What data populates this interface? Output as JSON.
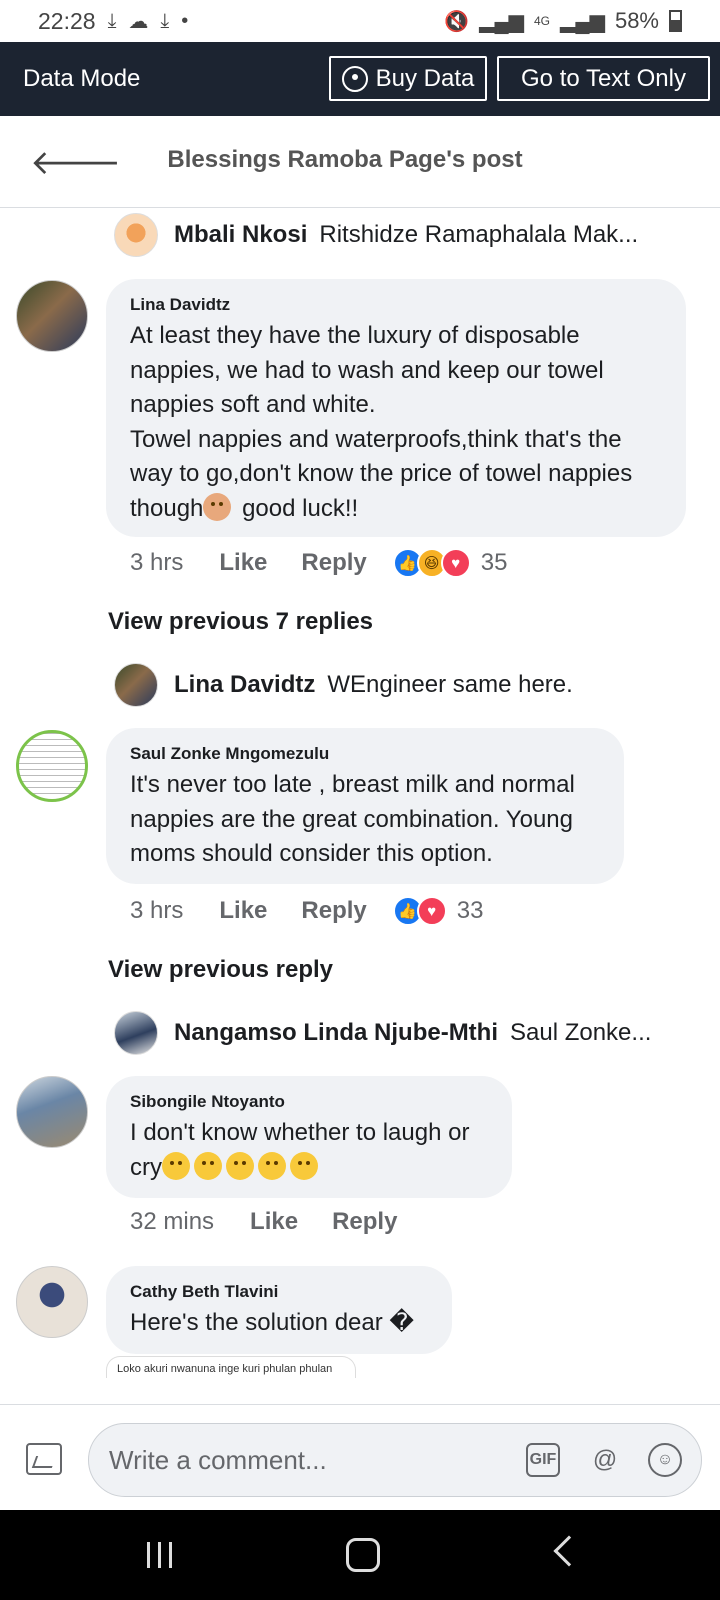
{
  "status_bar": {
    "time": "22:28",
    "network": "4G",
    "battery": "58%"
  },
  "data_bar": {
    "title": "Data Mode",
    "buy_data": "Buy Data",
    "text_only": "Go to Text Only"
  },
  "header": {
    "title": "Blessings Ramoba Page's post"
  },
  "replies": [
    {
      "name": "Mbali Nkosi",
      "text": "Ritshidze Ramaphalala Mak..."
    },
    {
      "name": "Lina Davidtz",
      "text": "WEngineer same here."
    },
    {
      "name": "Nangamso Linda Njube-Mthi",
      "text": "Saul Zonke..."
    }
  ],
  "comments": [
    {
      "name": "Lina Davidtz",
      "text": "At least they have the luxury of disposable nappies, we had to wash and keep our towel nappies soft and white.\nTowel nappies and waterproofs,think that's the way to go,don't know the price of towel nappies though",
      "text_end": " good luck!!",
      "time": "3 hrs",
      "like": "Like",
      "reply": "Reply",
      "reactions": "35"
    },
    {
      "name": "Saul Zonke Mngomezulu",
      "text": "It's never too late , breast milk and normal nappies are the great combination. Young moms should consider this option.",
      "time": "3 hrs",
      "like": "Like",
      "reply": "Reply",
      "reactions": "33"
    },
    {
      "name": "Sibongile Ntoyanto",
      "text": "I don't know whether to laugh or cry",
      "time": "32 mins",
      "like": "Like",
      "reply": "Reply"
    },
    {
      "name": "Cathy Beth Tlavini",
      "text": "Here's the solution dear �"
    }
  ],
  "view_previous": [
    "View previous 7 replies",
    "View previous reply"
  ],
  "attachment_caption": "Loko akuri nwanuna inge kuri phulan phulan",
  "composer": {
    "placeholder": "Write a comment...",
    "gif": "GIF",
    "at": "@"
  },
  "colors": {
    "accent": "#1877f2",
    "data_bar": "#1c2431",
    "bubble": "#f0f2f5"
  }
}
